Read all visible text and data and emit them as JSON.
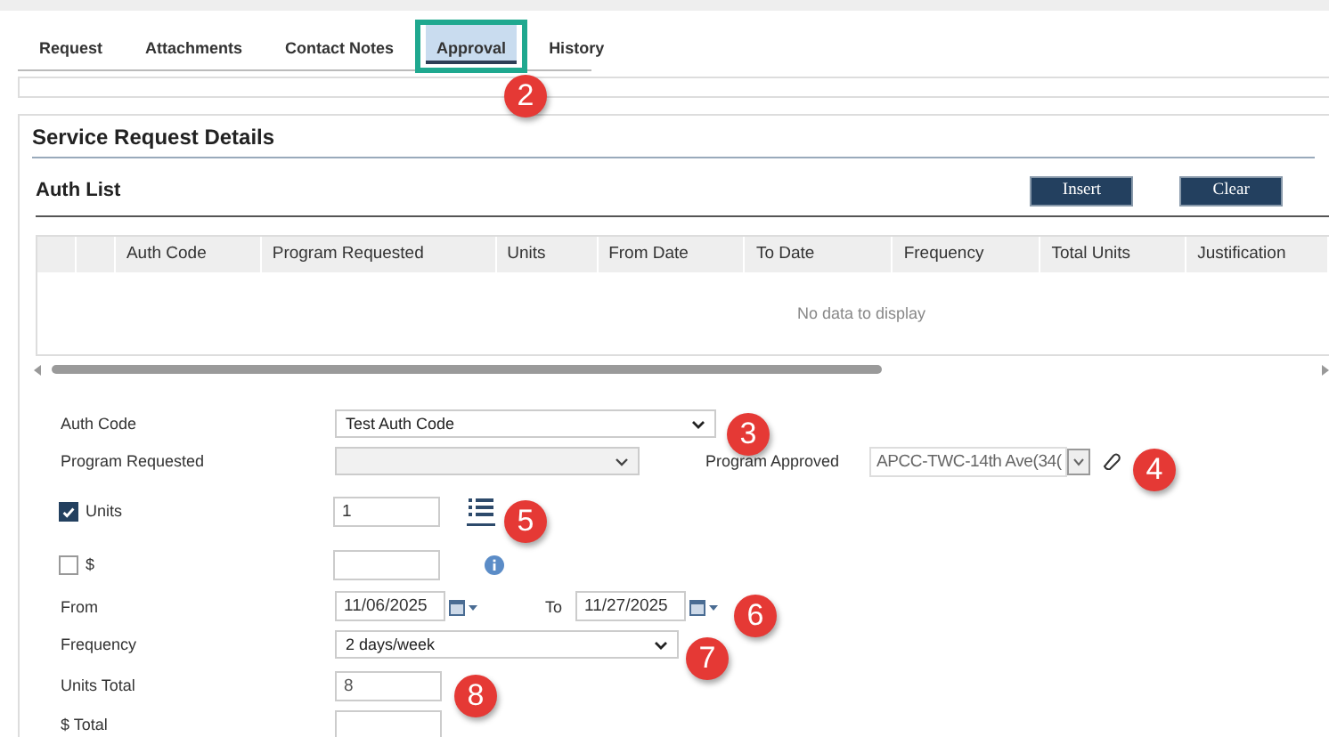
{
  "tabs": [
    {
      "label": "Request",
      "selected": false,
      "highlighted": false
    },
    {
      "label": "Attachments",
      "selected": false,
      "highlighted": false
    },
    {
      "label": "Contact Notes",
      "selected": false,
      "highlighted": false
    },
    {
      "label": "Approval",
      "selected": true,
      "highlighted": true
    },
    {
      "label": "History",
      "selected": false,
      "highlighted": false
    }
  ],
  "section_title": "Service Request Details",
  "auth_list": {
    "title": "Auth List",
    "buttons": [
      "Insert",
      "Clear"
    ],
    "columns": [
      "Auth Code",
      "Program Requested",
      "Units",
      "From Date",
      "To Date",
      "Frequency",
      "Total Units",
      "Justification"
    ],
    "empty_message": "No data to display"
  },
  "form": {
    "auth_code": {
      "label": "Auth Code",
      "value": "Test Auth Code"
    },
    "program_requested": {
      "label": "Program Requested",
      "disabled": true
    },
    "program_approved": {
      "label": "Program Approved",
      "value": "APCC-TWC-14th Ave(34("
    },
    "units": {
      "label": "Units",
      "checked": true,
      "value": "1"
    },
    "dollars": {
      "label": "$",
      "checked": false
    },
    "from": {
      "label": "From",
      "value": "11/06/2025"
    },
    "to": {
      "label": "To",
      "value": "11/27/2025"
    },
    "frequency": {
      "label": "Frequency",
      "value": "2 days/week"
    },
    "units_total": {
      "label": "Units Total",
      "value": "8"
    },
    "dollar_total": {
      "label": "$ Total"
    }
  },
  "callouts": [
    "2",
    "3",
    "4",
    "5",
    "6",
    "7",
    "8"
  ]
}
